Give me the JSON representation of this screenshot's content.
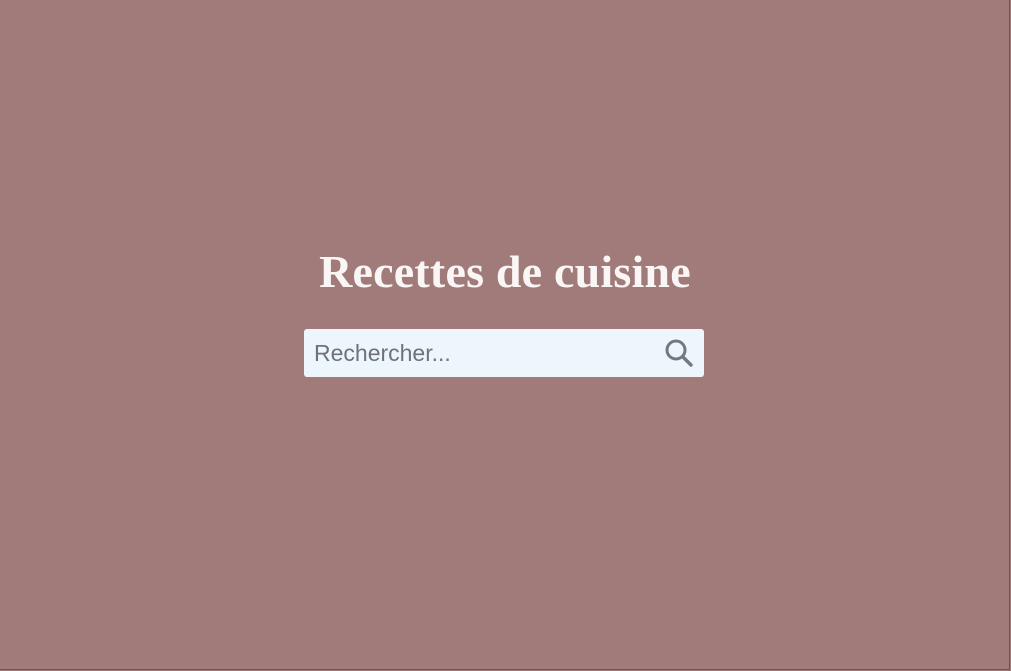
{
  "page": {
    "title": "Recettes de cuisine"
  },
  "search": {
    "placeholder": "Rechercher...",
    "value": "",
    "icon": "search-icon"
  },
  "colors": {
    "background": "#a07b7a",
    "title": "#fbf6f6",
    "search_background": "#edf5fd",
    "search_placeholder": "#6f7378",
    "search_icon": "#75797d"
  }
}
